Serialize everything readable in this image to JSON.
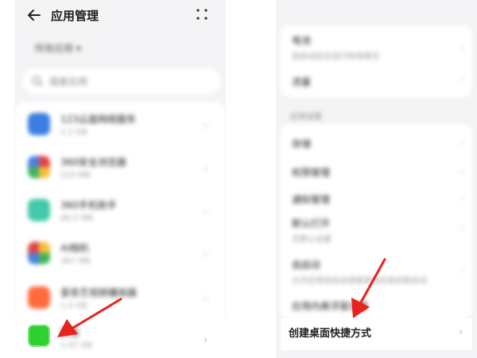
{
  "left": {
    "title": "应用管理",
    "filter_label": "所有应用 ▾",
    "search_placeholder": "搜索应用",
    "apps": [
      {
        "name": "123云盘网络服务",
        "sub": "1.2 GB",
        "color": "#3b7de0"
      },
      {
        "name": "360安全浏览器",
        "sub": "210 MB",
        "color": "#e04545"
      },
      {
        "name": "360手机助手",
        "sub": "86.5 MB",
        "color": "#42c9a8"
      },
      {
        "name": "AI相机",
        "sub": "367 MB",
        "color": "#5aa0e8"
      },
      {
        "name": "爱奇艺视频播放器",
        "sub": "1.4 GB",
        "color": "#ff6a3d"
      }
    ],
    "last_app": {
      "name": "微信",
      "sub": "1.07 GB",
      "color": "#2fd12f"
    }
  },
  "right": {
    "items_group1": [
      {
        "title": "电池",
        "sub": "自启动后台运行耗电情况"
      },
      {
        "title": "流量"
      }
    ],
    "section": "应用设置",
    "items_group2": [
      {
        "title": "存储"
      },
      {
        "title": "权限管理"
      },
      {
        "title": "通知管理"
      },
      {
        "title": "默认打开",
        "sub": "无默认设置"
      },
      {
        "title": "自启动",
        "sub": "允许应用自启动或被其他应用关联启动"
      },
      {
        "title": "应用内悬浮窗设置"
      }
    ],
    "shortcut_label": "创建桌面快捷方式"
  },
  "colors": {
    "arrow": "#e8231e",
    "panel_bg": "#f4f4f6"
  }
}
